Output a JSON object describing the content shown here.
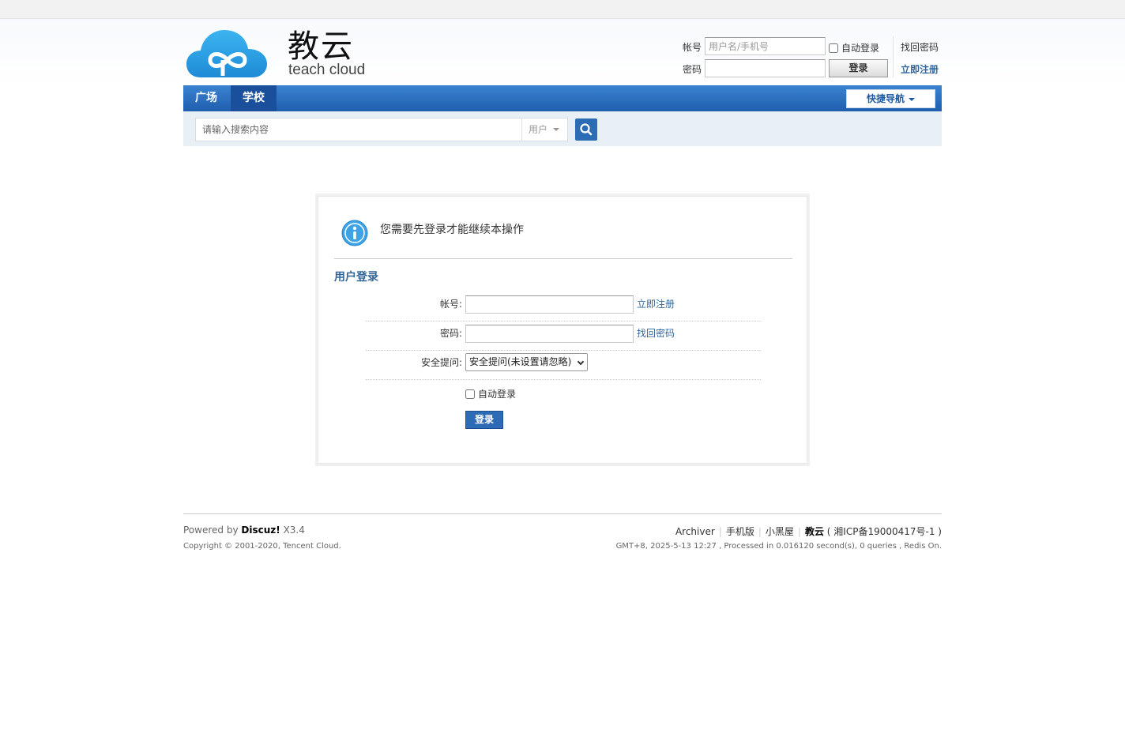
{
  "header": {
    "logo_cn": "教云",
    "logo_en": "teach cloud",
    "account_label": "帐号",
    "account_placeholder": "用户名/手机号",
    "password_label": "密码",
    "auto_login": "自动登录",
    "login_button": "登录",
    "forgot_password": "找回密码",
    "register": "立即注册"
  },
  "nav": {
    "items": [
      {
        "label": "广场"
      },
      {
        "label": "学校"
      }
    ],
    "quick_nav": "快捷导航"
  },
  "search": {
    "placeholder": "请输入搜索内容",
    "type": "用户"
  },
  "message": {
    "text": "您需要先登录才能继续本操作",
    "login_title": "用户登录",
    "account_label": "帐号:",
    "register_link": "立即注册",
    "password_label": "密码:",
    "forgot_link": "找回密码",
    "question_label": "安全提问:",
    "question_value": "安全提问(未设置请忽略)",
    "auto_login": "自动登录",
    "submit": "登录"
  },
  "footer": {
    "powered_prefix": "Powered by",
    "powered_name": "Discuz!",
    "powered_version": "X3.4",
    "copyright": "Copyright © 2001-2020, Tencent Cloud.",
    "links": [
      "Archiver",
      "手机版",
      "小黑屋"
    ],
    "site_name": "教云",
    "icp": "( 湘ICP备19000417号-1 )",
    "stats": "GMT+8, 2025-5-13 12:27 , Processed in 0.016120 second(s), 0 queries , Redis On."
  },
  "colors": {
    "nav": "#2a6fc0",
    "link": "#336699",
    "search_bg": "#e8eff5"
  }
}
